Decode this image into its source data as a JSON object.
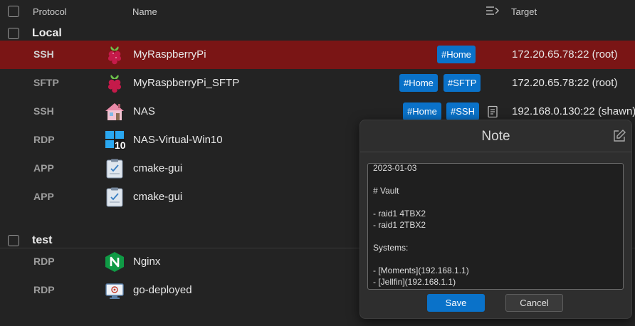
{
  "header": {
    "protocol_label": "Protocol",
    "name_label": "Name",
    "target_label": "Target",
    "columns_icon": "list-indent-icon"
  },
  "groups": [
    {
      "title": "Local",
      "rows": [
        {
          "protocol": "SSH",
          "name": "MyRaspberryPi",
          "icon": "raspberry-pi-icon",
          "tags": [
            "#Home"
          ],
          "target": "172.20.65.78:22 (root)",
          "selected": true
        },
        {
          "protocol": "SFTP",
          "name": "MyRaspberryPi_SFTP",
          "icon": "raspberry-pi-icon",
          "tags": [
            "#Home",
            "#SFTP"
          ],
          "target": "172.20.65.78:22 (root)"
        },
        {
          "protocol": "SSH",
          "name": "NAS",
          "icon": "house-icon",
          "tags": [
            "#Home",
            "#SSH"
          ],
          "target": "192.168.0.130:22 (shawn)",
          "has_note": true
        },
        {
          "protocol": "RDP",
          "name": "NAS-Virtual-Win10",
          "icon": "windows-10-icon",
          "tags": [],
          "target": ""
        },
        {
          "protocol": "APP",
          "name": "cmake-gui",
          "icon": "clipboard-icon",
          "tags": [],
          "target": ""
        },
        {
          "protocol": "APP",
          "name": "cmake-gui",
          "icon": "clipboard-icon",
          "tags": [],
          "target": ""
        }
      ]
    },
    {
      "title": "test",
      "rows": [
        {
          "protocol": "RDP",
          "name": "Nginx",
          "icon": "nginx-icon",
          "tags": [],
          "target": ""
        },
        {
          "protocol": "RDP",
          "name": "go-deployed",
          "icon": "remote-desktop-icon",
          "tags": [],
          "target": ""
        }
      ]
    }
  ],
  "note_dialog": {
    "title": "Note",
    "lines": [
      "2023-01-03",
      "",
      "# Vault",
      "",
      "- raid1 4TBX2",
      "- raid1 2TBX2",
      "",
      "Systems:",
      "",
      "- [Moments](192.168.1.1)",
      "- [Jellfin](192.168.1.1)"
    ],
    "save_label": "Save",
    "cancel_label": "Cancel"
  },
  "colors": {
    "background": "#232323",
    "selected_row": "#7a1515",
    "tag": "#0a72c9",
    "save_button": "#0a72c9"
  }
}
